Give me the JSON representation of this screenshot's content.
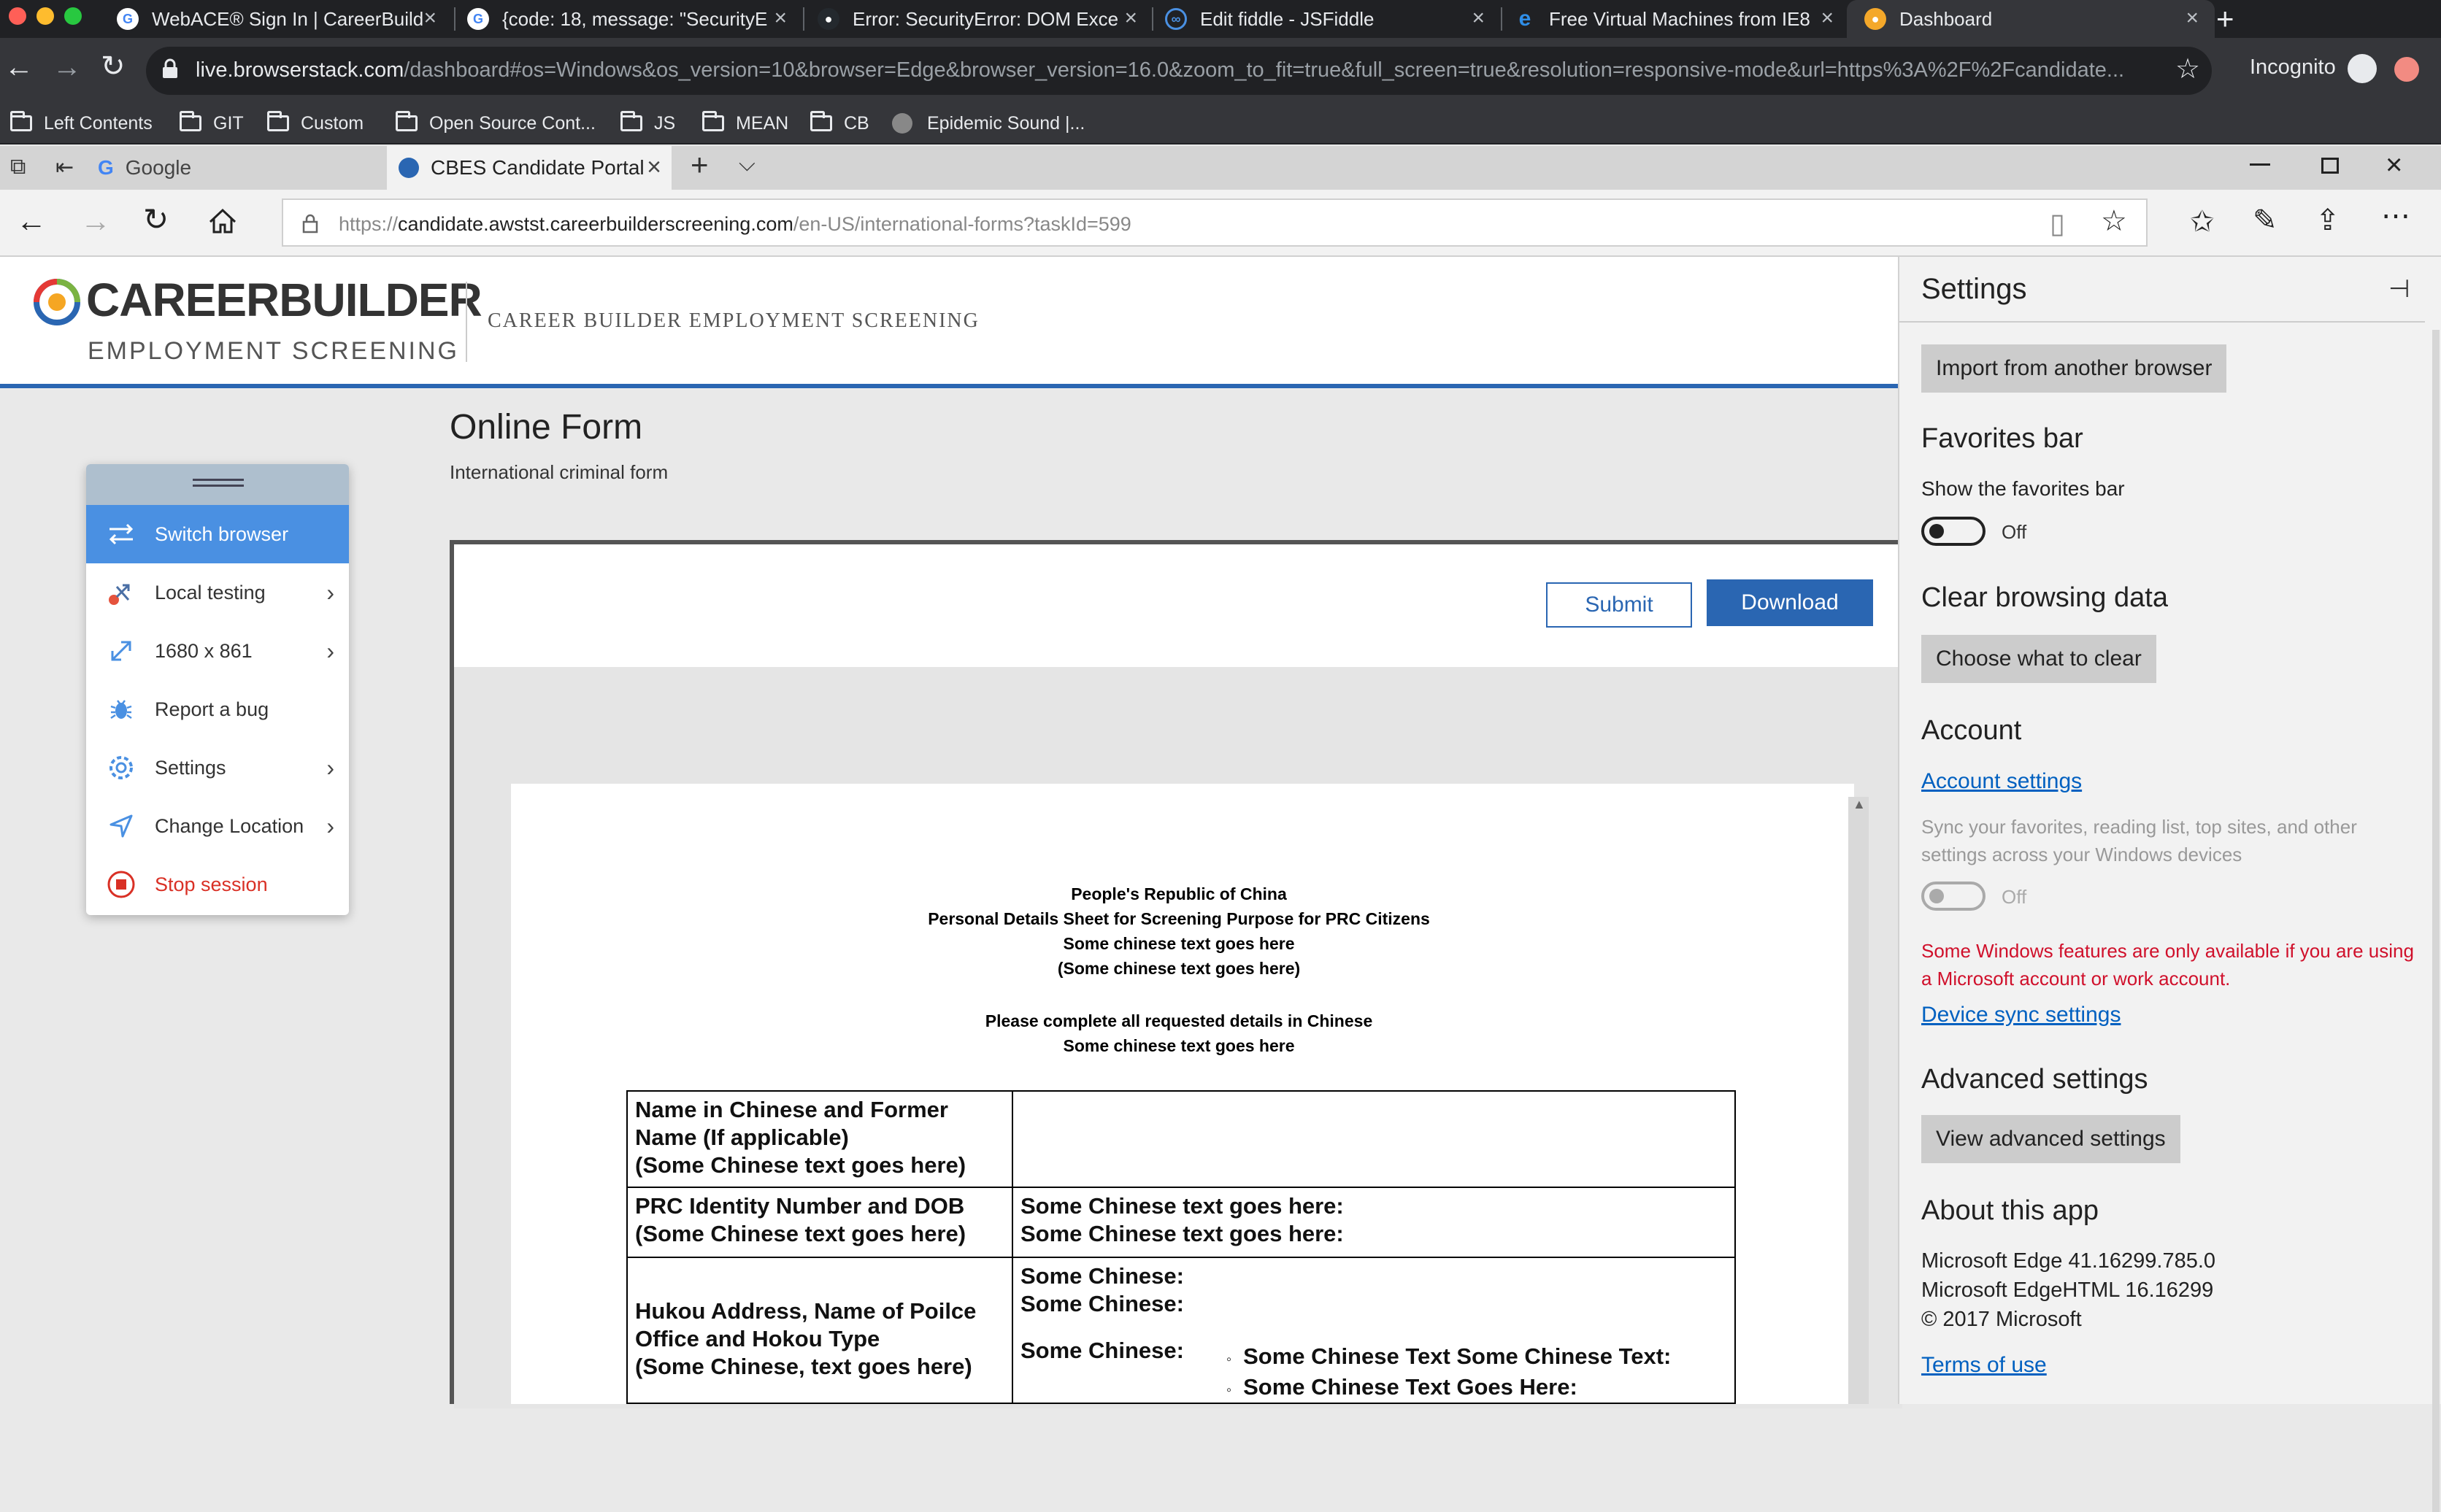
{
  "chrome": {
    "tabs": [
      {
        "title": "WebACE® Sign In | CareerBuild"
      },
      {
        "title": "{code: 18, message: \"SecurityE"
      },
      {
        "title": "Error: SecurityError: DOM Exce"
      },
      {
        "title": "Edit fiddle - JSFiddle"
      },
      {
        "title": "Free Virtual Machines from IE8"
      },
      {
        "title": "Dashboard"
      }
    ],
    "url_host": "live.browserstack.com",
    "url_rest": "/dashboard#os=Windows&os_version=10&browser=Edge&browser_version=16.0&zoom_to_fit=true&full_screen=true&resolution=responsive-mode&url=https%3A%2F%2Fcandidate...",
    "incognito_label": "Incognito",
    "bookmarks": [
      "Left Contents",
      "GIT",
      "Custom",
      "Open Source Cont...",
      "JS",
      "MEAN",
      "CB",
      "Epidemic Sound |..."
    ]
  },
  "edge": {
    "tabs": [
      {
        "title": "Google"
      },
      {
        "title": "CBES Candidate Portal"
      }
    ],
    "url_prefix": "https://",
    "url_host": "candidate.awstst.careerbuilderscreening.com",
    "url_path": "/en-US/international-forms?taskId=599"
  },
  "site": {
    "logo_top": "CAREERBUILDER",
    "logo_bottom": "EMPLOYMENT SCREENING",
    "header_title": "CAREER BUILDER EMPLOYMENT SCREENING",
    "form_title": "Online Form",
    "form_subtitle": "International criminal form",
    "submit_label": "Submit",
    "download_label": "Download"
  },
  "document": {
    "lines": [
      "People's Republic of China",
      "Personal Details Sheet for Screening Purpose for PRC Citizens",
      "Some chinese text goes here",
      "(Some chinese text goes here)",
      "Please complete all requested details in Chinese",
      "Some chinese text goes here"
    ],
    "rows": [
      {
        "label": [
          "Name in Chinese and Former",
          "Name (If applicable)",
          "(Some Chinese text goes here)"
        ],
        "value": []
      },
      {
        "label": [
          "PRC Identity Number and DOB",
          "(Some Chinese text goes here)"
        ],
        "value": [
          "Some Chinese text goes here:",
          "Some Chinese text goes here:"
        ]
      },
      {
        "label": [
          "Hukou Address, Name of Poilce",
          "Office and Hokou Type",
          "(Some Chinese, text goes here)"
        ],
        "value": [
          "Some Chinese:",
          "Some Chinese:",
          "Some Chinese:"
        ],
        "bullets": [
          "Some Chinese Text Some Chinese Text:",
          "Some Chinese Text Goes Here:"
        ]
      }
    ]
  },
  "bs_menu": {
    "items": [
      {
        "label": "Switch browser",
        "icon": "switch-icon"
      },
      {
        "label": "Local testing",
        "icon": "local-testing-icon"
      },
      {
        "label": "1680 x 861",
        "icon": "resize-icon"
      },
      {
        "label": "Report a bug",
        "icon": "bug-icon"
      },
      {
        "label": "Settings",
        "icon": "gear-icon"
      },
      {
        "label": "Change Location",
        "icon": "location-icon"
      },
      {
        "label": "Stop session",
        "icon": "stop-icon"
      }
    ]
  },
  "settings": {
    "title": "Settings",
    "import_label": "Import from another browser",
    "favorites_heading": "Favorites bar",
    "show_favorites_label": "Show the favorites bar",
    "toggle_off": "Off",
    "clear_heading": "Clear browsing data",
    "clear_button": "Choose what to clear",
    "account_heading": "Account",
    "account_link": "Account settings",
    "sync_desc_1": "Sync your favorites, reading list, top sites, and other",
    "sync_desc_2": "settings across your Windows devices",
    "warning_1": "Some Windows features are only available if you are using",
    "warning_2": "a Microsoft account or work account.",
    "device_sync_link": "Device sync settings",
    "advanced_heading": "Advanced settings",
    "advanced_button": "View advanced settings",
    "about_heading": "About this app",
    "about_lines": [
      "Microsoft Edge 41.16299.785.0",
      "Microsoft EdgeHTML 16.16299",
      "© 2017 Microsoft"
    ],
    "terms_link": "Terms of use"
  },
  "colors": {
    "accent": "#2a66b2",
    "bs_highlight": "#4a90e2",
    "stop_red": "#d93025",
    "warning_red": "#d0102b"
  }
}
